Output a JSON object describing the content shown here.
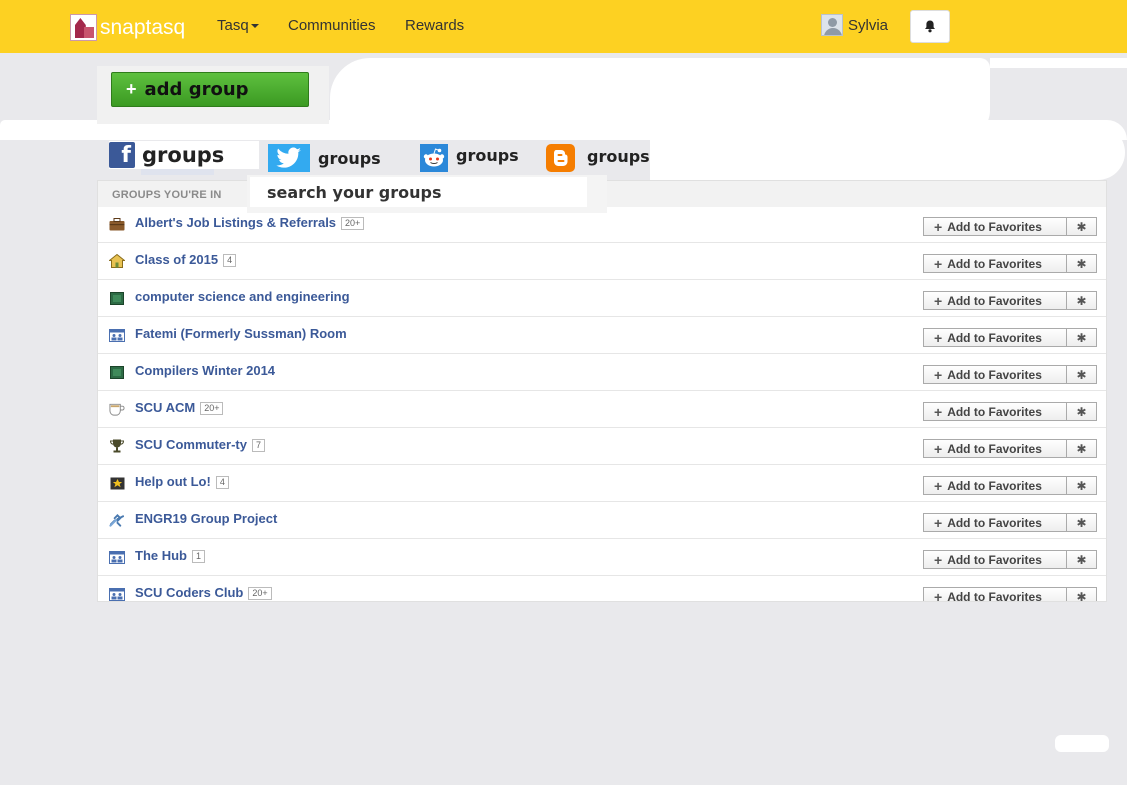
{
  "header": {
    "brand": "snaptasq",
    "nav": {
      "tasq": "Tasq",
      "communities": "Communities",
      "rewards": "Rewards"
    },
    "user": {
      "name": "Sylvia"
    },
    "icons": {
      "bell": "bell-icon",
      "avatar": "user-avatar-icon",
      "logo": "snaptasq-logo"
    }
  },
  "add_group": {
    "label": "add group",
    "plus": "+"
  },
  "sources": [
    {
      "name": "facebook",
      "label": "groups",
      "icon": "facebook-icon"
    },
    {
      "name": "twitter",
      "label": "groups",
      "icon": "twitter-icon"
    },
    {
      "name": "reddit",
      "label": "groups",
      "icon": "reddit-icon"
    },
    {
      "name": "blogger",
      "label": "groups",
      "icon": "blogger-icon"
    }
  ],
  "panel": {
    "title": "GROUPS YOU'RE IN",
    "search_placeholder": "search your groups",
    "fav_label": "Add to Favorites",
    "fav_plus": "+",
    "gear": "✱"
  },
  "groups": [
    {
      "name": "Albert's Job Listings & Referrals",
      "count": "20+",
      "icon": "briefcase-icon"
    },
    {
      "name": "Class of 2015",
      "count": "4",
      "icon": "school-icon"
    },
    {
      "name": "computer science and engineering",
      "count": "",
      "icon": "book-icon"
    },
    {
      "name": "Fatemi (Formerly Sussman) Room",
      "count": "",
      "icon": "group-icon"
    },
    {
      "name": "Compilers Winter 2014",
      "count": "",
      "icon": "book-icon"
    },
    {
      "name": "SCU ACM",
      "count": "20+",
      "icon": "coffee-icon"
    },
    {
      "name": "SCU Commuter-ty",
      "count": "7",
      "icon": "trophy-icon"
    },
    {
      "name": "Help out Lo!",
      "count": "4",
      "icon": "star-icon"
    },
    {
      "name": "ENGR19 Group Project",
      "count": "",
      "icon": "link-icon"
    },
    {
      "name": "The Hub",
      "count": "1",
      "icon": "group-icon"
    },
    {
      "name": "SCU Coders Club",
      "count": "20+",
      "icon": "group-icon"
    }
  ]
}
